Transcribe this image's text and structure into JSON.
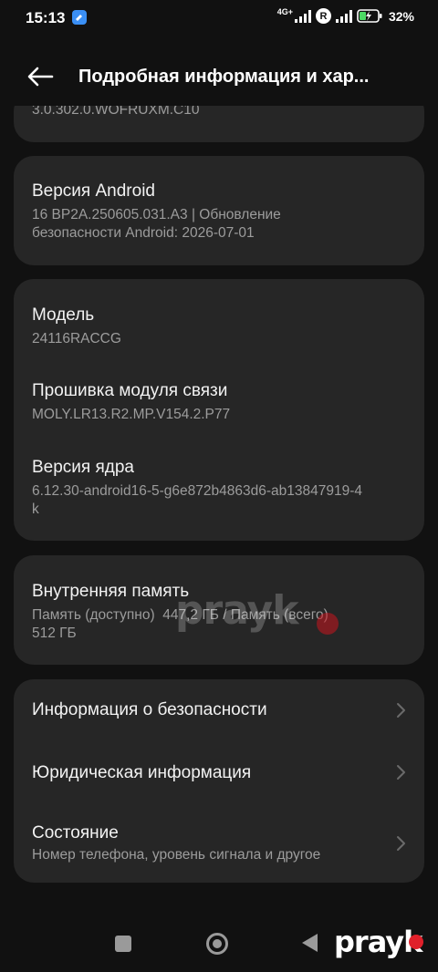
{
  "status": {
    "time": "15:13",
    "network": "4G+",
    "roaming": "R",
    "battery": "32%"
  },
  "header": {
    "title": "Подробная информация и хар..."
  },
  "top_card": {
    "cut_text": "3.0.302.0.WOFRUXM.C10"
  },
  "android_card": {
    "title": "Версия Android",
    "value_line1": "16 BP2A.250605.031.A3 | Обновление",
    "value_line2": "безопасности Android: 2026-07-01"
  },
  "device_card": {
    "model_title": "Модель",
    "model_value": "24116RACCG",
    "baseband_title": "Прошивка модуля связи",
    "baseband_value": "MOLY.LR13.R2.MP.V154.2.P77",
    "kernel_title": "Версия ядра",
    "kernel_value_line1": "6.12.30-android16-5-g6e872b4863d6-ab13847919-4",
    "kernel_value_line2": "k"
  },
  "storage_card": {
    "title": "Внутренняя память",
    "value_line1": "Память (доступно)  447,2 ГБ / Память (всего)",
    "value_line2": "512 ГБ"
  },
  "links_card": {
    "security_info": "Информация о безопасности",
    "legal_info": "Юридическая информация",
    "status_title": "Состояние",
    "status_sub": "Номер телефона, уровень сигнала и другое"
  },
  "watermark": {
    "text": "prayk"
  },
  "colors": {
    "background": "#111111",
    "card": "#262626",
    "primary_text": "#f2f2f2",
    "secondary_text": "#9c9c9c",
    "watermark_dot": "#e0202a"
  }
}
